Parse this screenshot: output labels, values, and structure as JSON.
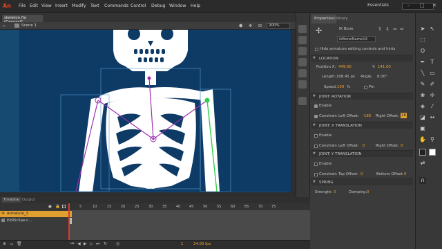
{
  "app": {
    "logo": "An",
    "menus": [
      "File",
      "Edit",
      "View",
      "Insert",
      "Modify",
      "Text",
      "Commands",
      "Control",
      "Debug",
      "Window",
      "Help"
    ],
    "workspace": "Essentials",
    "window_controls": [
      "–",
      "□",
      "✕"
    ]
  },
  "document": {
    "tab_label": "skeleton.fla (Canvas)*",
    "scene_label": "Scene 1",
    "zoom": "200%"
  },
  "properties": {
    "tabs": [
      "Properties",
      "Library"
    ],
    "object_type": "IK Bone",
    "instance_name": "ikBoneName14",
    "hide_controls_label": "Hide armature editing controls and hints",
    "sections": {
      "location": "LOCATION",
      "joint_rotation": "JOINT: ROTATION",
      "joint_x": "JOINT: X TRANSLATION",
      "joint_y": "JOINT: Y TRANSLATION",
      "spring": "SPRING"
    },
    "location": {
      "position_x_label": "Position X:",
      "position_x": "449.00",
      "y_label": "Y:",
      "y": "141.00",
      "length_label": "Length:",
      "length": "108.45 px",
      "angle_label": "Angle:",
      "angle": "8.00°",
      "speed_label": "Speed:",
      "speed": "100",
      "speed_unit": "%",
      "pin_label": "Pin"
    },
    "rotation": {
      "enable_label": "Enable",
      "constrain_label": "Constrain",
      "left_label": "Left Offset:",
      "left_value": "-180",
      "right_label": "Right Offset:",
      "right_value": "18"
    },
    "xtrans": {
      "enable_label": "Enable",
      "constrain_label": "Constrain",
      "left_label": "Left Offset:",
      "left_value": "0",
      "right_label": "Right Offset:",
      "right_value": "0"
    },
    "ytrans": {
      "enable_label": "Enable",
      "constrain_label": "Constrain",
      "top_label": "Top Offset:",
      "top_value": "0",
      "bottom_label": "Bottom Offset:",
      "bottom_value": "0"
    },
    "spring": {
      "strength_label": "Strength:",
      "strength_value": "0",
      "damping_label": "Damping:",
      "damping_value": "0"
    }
  },
  "timeline": {
    "tabs": [
      "Timeline",
      "Output"
    ],
    "ruler": [
      "1",
      "5",
      "10",
      "15",
      "20",
      "25",
      "30",
      "35",
      "40",
      "45",
      "50",
      "55",
      "60",
      "65",
      "70",
      "75"
    ],
    "layers": [
      "Armature_3",
      "Ed05c5ae-c…"
    ],
    "fps": "24.00 fps",
    "frame": "1"
  },
  "colors": {
    "stage": "#0e3a66",
    "bone": "#9b2fae",
    "accent": "#f0a030",
    "green_bone": "#2fd04a"
  }
}
